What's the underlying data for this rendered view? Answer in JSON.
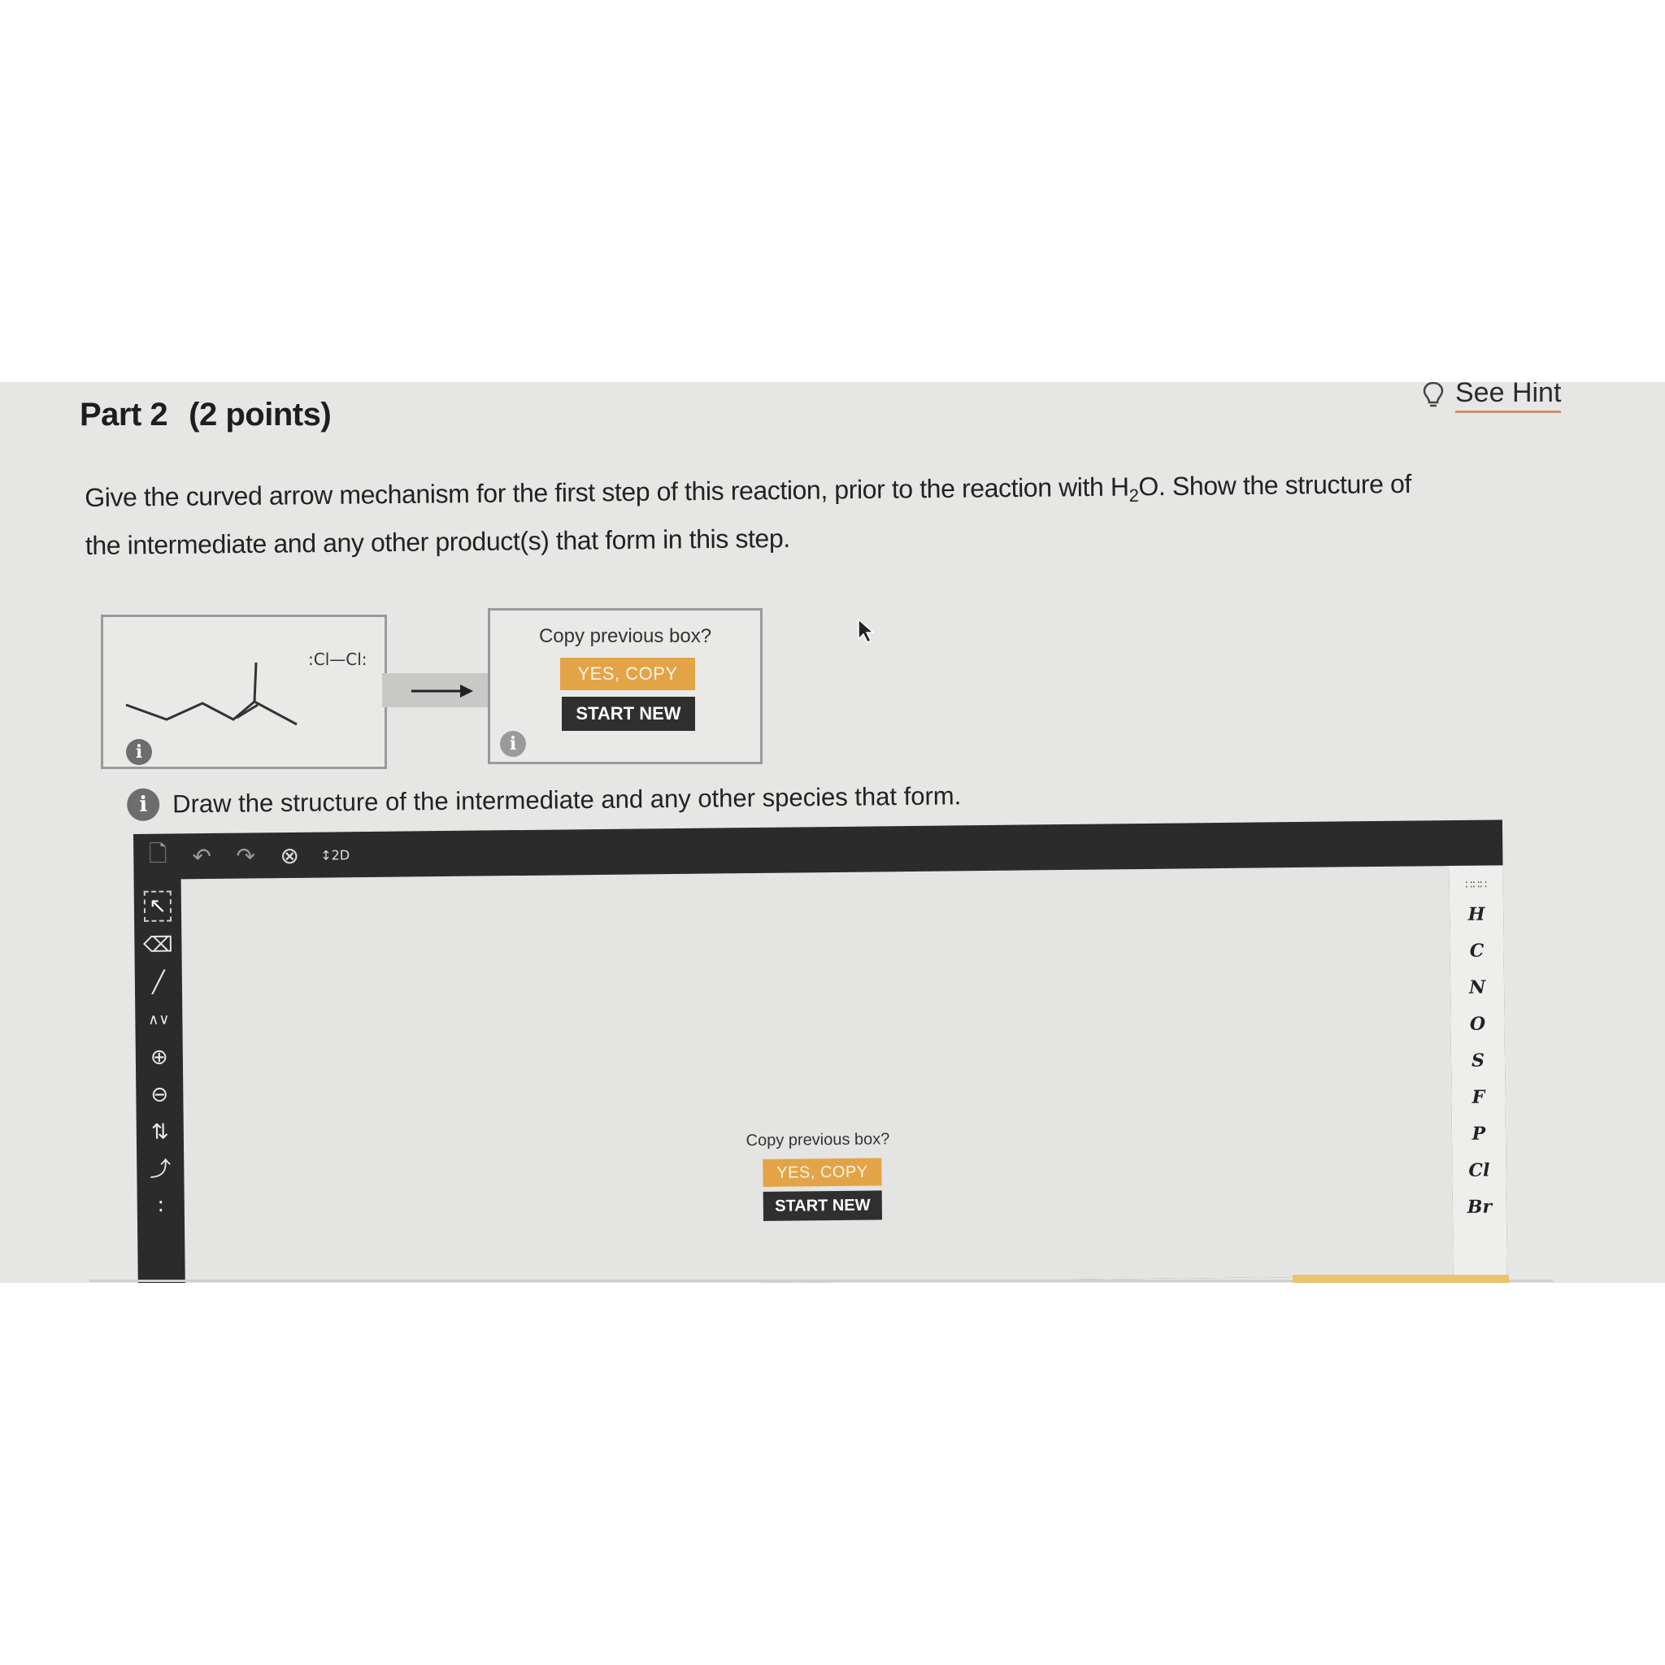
{
  "part": {
    "title": "Part 2",
    "points": "(2 points)"
  },
  "hint": {
    "label": "See Hint",
    "icon": "lightbulb-icon"
  },
  "question": {
    "before": "Give the curved arrow mechanism for the first step of this reaction, prior to the reaction with H",
    "subscript": "2",
    "after": "O. Show the structure of the intermediate and any other product(s) that form in this step."
  },
  "reactant": {
    "reagent_left_atom": ":Cl",
    "reagent_bond": "—",
    "reagent_right_atom": "Cl:",
    "info_icon": "info-icon"
  },
  "product_box": {
    "copy_prompt": "Copy previous box?",
    "yes_copy": "YES, COPY",
    "start_new": "START NEW"
  },
  "draw_instruction": "Draw the structure of the intermediate and any other species that form.",
  "editor": {
    "toolbar": [
      "new-document-icon",
      "undo-icon",
      "redo-icon",
      "zoom-clear-icon",
      "2d-clean-icon"
    ],
    "toolbar_2d_label": "2D",
    "left_tools": [
      "selection-icon",
      "eraser-icon",
      "bond-icon",
      "chain-icon",
      "positive-charge-icon",
      "negative-charge-icon",
      "electron-push-arrow-icon",
      "curved-arrow-icon",
      "lone-pair-icon"
    ],
    "elements": [
      "H",
      "C",
      "N",
      "O",
      "S",
      "F",
      "P",
      "Cl",
      "Br"
    ],
    "canvas": {
      "copy_prompt": "Copy previous box?",
      "yes_copy": "YES, COPY",
      "start_new": "START NEW"
    }
  },
  "colors": {
    "accent_orange": "#e3a448",
    "dark_button": "#2f2f2f",
    "editor_frame": "#2b2b2b"
  }
}
